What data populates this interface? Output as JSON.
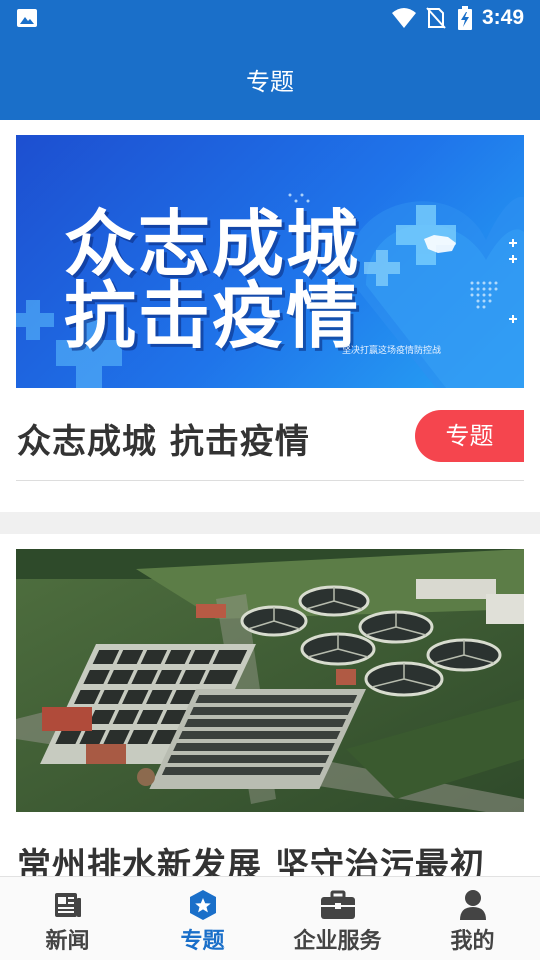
{
  "status_bar": {
    "time": "3:49",
    "icons": [
      "gallery-icon",
      "wifi-icon",
      "no-sim-icon",
      "battery-charging-icon"
    ]
  },
  "header": {
    "title": "专题"
  },
  "cards": [
    {
      "banner": {
        "line1": "众志成城",
        "line2": "抗击疫情",
        "caption": "坚决打赢这场疫情防控战"
      },
      "title": "众志成城 抗击疫情",
      "badge": "专题"
    },
    {
      "image": "water-treatment-plant-aerial-photo",
      "title": "常州排水新发展 坚守治污最初"
    }
  ],
  "bottom_nav": {
    "active": "专题",
    "items": [
      {
        "label": "新闻",
        "icon": "newspaper-icon"
      },
      {
        "label": "专题",
        "icon": "topic-badge-icon"
      },
      {
        "label": "企业服务",
        "icon": "briefcase-icon"
      },
      {
        "label": "我的",
        "icon": "person-icon"
      }
    ]
  },
  "colors": {
    "primary": "#1a6fc9",
    "badge": "#f5454e",
    "title_text": "#333333",
    "nav_text": "#444444"
  }
}
